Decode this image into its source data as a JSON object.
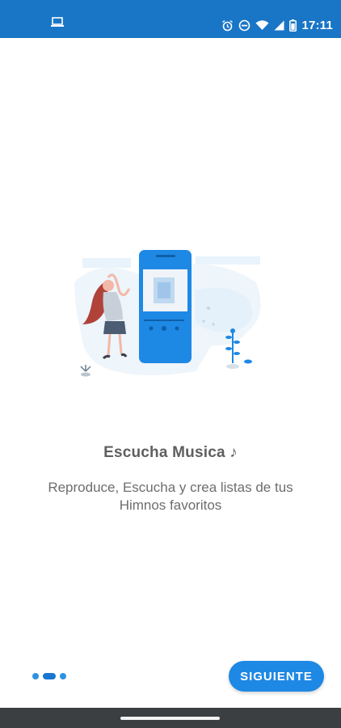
{
  "status_bar": {
    "time": "17:11",
    "left_icon": "laptop-icon",
    "right_icons": [
      "alarm-icon",
      "do-not-disturb-icon",
      "wifi-icon",
      "signal-icon",
      "battery-icon"
    ]
  },
  "onboarding": {
    "title": "Escucha Musica ♪",
    "description": "Reproduce, Escucha y crea listas de tus Himnos favoritos",
    "illustration": "woman-dancing-with-phone-illustration",
    "page_index": 2,
    "page_count": 3
  },
  "actions": {
    "next_label": "SIGUIENTE"
  },
  "colors": {
    "primary": "#1976c7",
    "accent": "#1e88e5",
    "text_primary": "#5f5f5f",
    "text_secondary": "#6d6d6d",
    "nav_bar": "#3b3f42"
  }
}
